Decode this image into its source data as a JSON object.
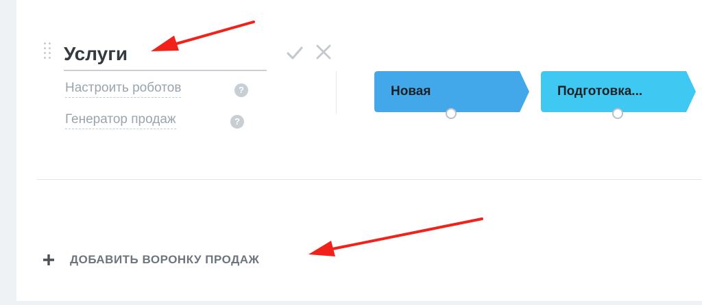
{
  "pipeline": {
    "title_value": "Услуги",
    "links": [
      {
        "label": "Настроить роботов",
        "help": "?"
      },
      {
        "label": "Генератор продаж",
        "help": "?"
      }
    ],
    "stages": [
      {
        "label": "Новая",
        "color": "#42a8ea"
      },
      {
        "label": "Подготовка...",
        "color": "#3fc8f2"
      }
    ]
  },
  "actions": {
    "add_funnel_label": "ДОБАВИТЬ ВОРОНКУ ПРОДАЖ"
  },
  "annotations": {
    "arrow_color": "#f2211a"
  }
}
